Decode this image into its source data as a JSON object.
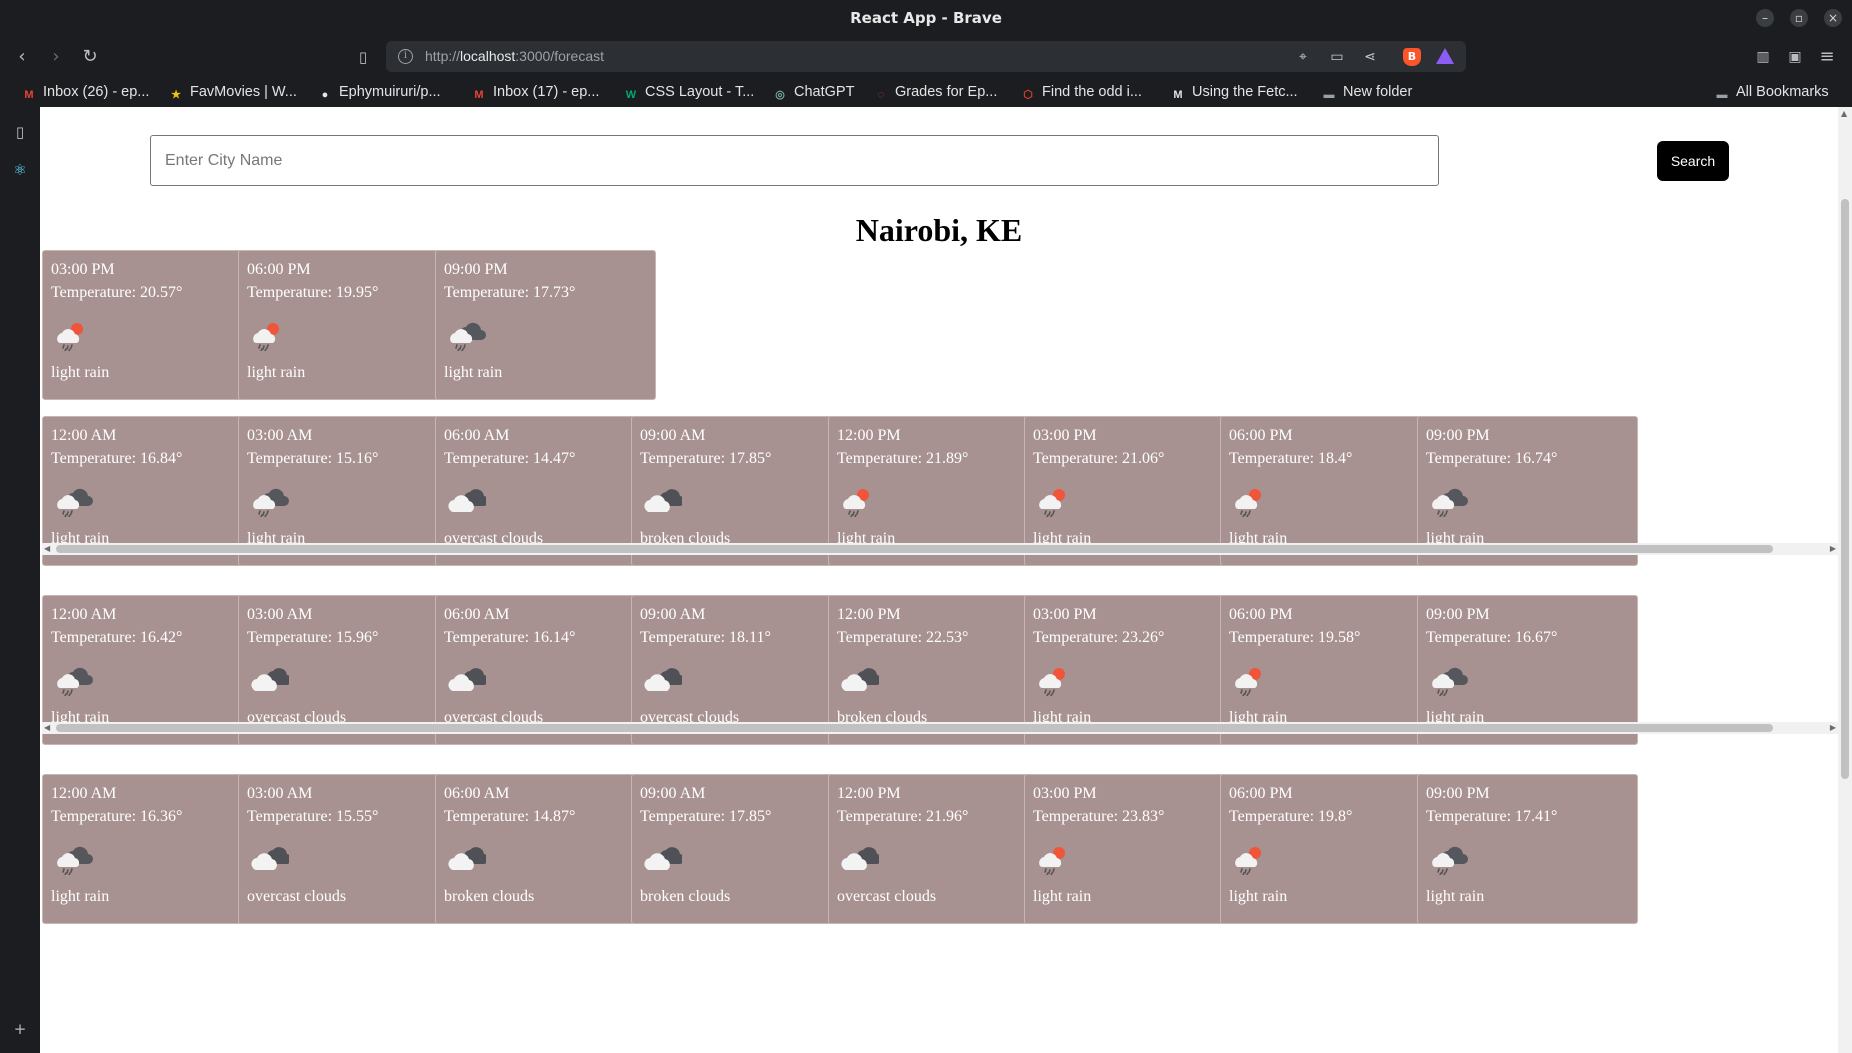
{
  "window": {
    "title": "React App - Brave",
    "controls": [
      "–",
      "▫",
      "×"
    ]
  },
  "toolbar": {
    "url_scheme": "http://",
    "url_host": "localhost",
    "url_path": ":3000/forecast"
  },
  "bookmarks": [
    {
      "label": "Inbox (26) - ep...",
      "icon": "gmail-icon",
      "color": "#ea4335",
      "glyph": "M"
    },
    {
      "label": "FavMovies | W...",
      "icon": "star-icon",
      "color": "#f4c20d",
      "glyph": "★"
    },
    {
      "label": "Ephymuiruri/p...",
      "icon": "github-icon",
      "color": "#e4e4e4",
      "glyph": "●"
    },
    {
      "label": "Inbox (17) - ep...",
      "icon": "gmail-icon",
      "color": "#ea4335",
      "glyph": "M"
    },
    {
      "label": "CSS Layout - T...",
      "icon": "w3schools-icon",
      "color": "#04aa6d",
      "glyph": "W"
    },
    {
      "label": "ChatGPT",
      "icon": "chatgpt-icon",
      "color": "#74aa9c",
      "glyph": "◎"
    },
    {
      "label": "Grades for Ep...",
      "icon": "canvas-icon",
      "color": "#e13f2b",
      "glyph": "◌"
    },
    {
      "label": "Find the odd i...",
      "icon": "codewars-icon",
      "color": "#e13f2b",
      "glyph": "⬡"
    },
    {
      "label": "Using the Fetc...",
      "icon": "mdn-icon",
      "color": "#e4e4e4",
      "glyph": "M"
    },
    {
      "label": "New folder",
      "icon": "folder-icon",
      "color": "#9aa0a6",
      "glyph": "▬"
    }
  ],
  "all_bookmarks_label": "All Bookmarks",
  "search": {
    "placeholder": "Enter City Name",
    "button_label": "Search"
  },
  "city": "Nairobi, KE",
  "days": [
    [
      {
        "time": "03:00 PM",
        "temp": "Temperature: 20.57°",
        "desc": "light rain",
        "icon": "rain-sun"
      },
      {
        "time": "06:00 PM",
        "temp": "Temperature: 19.95°",
        "desc": "light rain",
        "icon": "rain-sun"
      },
      {
        "time": "09:00 PM",
        "temp": "Temperature: 17.73°",
        "desc": "light rain",
        "icon": "rain-night"
      }
    ],
    [
      {
        "time": "12:00 AM",
        "temp": "Temperature: 16.84°",
        "desc": "light rain",
        "icon": "rain-night"
      },
      {
        "time": "03:00 AM",
        "temp": "Temperature: 15.16°",
        "desc": "light rain",
        "icon": "rain-night"
      },
      {
        "time": "06:00 AM",
        "temp": "Temperature: 14.47°",
        "desc": "overcast clouds",
        "icon": "clouds"
      },
      {
        "time": "09:00 AM",
        "temp": "Temperature: 17.85°",
        "desc": "broken clouds",
        "icon": "clouds"
      },
      {
        "time": "12:00 PM",
        "temp": "Temperature: 21.89°",
        "desc": "light rain",
        "icon": "rain-sun"
      },
      {
        "time": "03:00 PM",
        "temp": "Temperature: 21.06°",
        "desc": "light rain",
        "icon": "rain-sun"
      },
      {
        "time": "06:00 PM",
        "temp": "Temperature: 18.4°",
        "desc": "light rain",
        "icon": "rain-sun"
      },
      {
        "time": "09:00 PM",
        "temp": "Temperature: 16.74°",
        "desc": "light rain",
        "icon": "rain-night"
      }
    ],
    [
      {
        "time": "12:00 AM",
        "temp": "Temperature: 16.42°",
        "desc": "light rain",
        "icon": "rain-night"
      },
      {
        "time": "03:00 AM",
        "temp": "Temperature: 15.96°",
        "desc": "overcast clouds",
        "icon": "clouds"
      },
      {
        "time": "06:00 AM",
        "temp": "Temperature: 16.14°",
        "desc": "overcast clouds",
        "icon": "clouds"
      },
      {
        "time": "09:00 AM",
        "temp": "Temperature: 18.11°",
        "desc": "overcast clouds",
        "icon": "clouds"
      },
      {
        "time": "12:00 PM",
        "temp": "Temperature: 22.53°",
        "desc": "broken clouds",
        "icon": "clouds"
      },
      {
        "time": "03:00 PM",
        "temp": "Temperature: 23.26°",
        "desc": "light rain",
        "icon": "rain-sun"
      },
      {
        "time": "06:00 PM",
        "temp": "Temperature: 19.58°",
        "desc": "light rain",
        "icon": "rain-sun"
      },
      {
        "time": "09:00 PM",
        "temp": "Temperature: 16.67°",
        "desc": "light rain",
        "icon": "rain-night"
      }
    ],
    [
      {
        "time": "12:00 AM",
        "temp": "Temperature: 16.36°",
        "desc": "light rain",
        "icon": "rain-night"
      },
      {
        "time": "03:00 AM",
        "temp": "Temperature: 15.55°",
        "desc": "overcast clouds",
        "icon": "clouds"
      },
      {
        "time": "06:00 AM",
        "temp": "Temperature: 14.87°",
        "desc": "broken clouds",
        "icon": "clouds"
      },
      {
        "time": "09:00 AM",
        "temp": "Temperature: 17.85°",
        "desc": "broken clouds",
        "icon": "clouds"
      },
      {
        "time": "12:00 PM",
        "temp": "Temperature: 21.96°",
        "desc": "overcast clouds",
        "icon": "clouds"
      },
      {
        "time": "03:00 PM",
        "temp": "Temperature: 23.83°",
        "desc": "light rain",
        "icon": "rain-sun"
      },
      {
        "time": "06:00 PM",
        "temp": "Temperature: 19.8°",
        "desc": "light rain",
        "icon": "rain-sun"
      },
      {
        "time": "09:00 PM",
        "temp": "Temperature: 17.41°",
        "desc": "light rain",
        "icon": "rain-night"
      }
    ]
  ],
  "colors": {
    "card_bg": "#a89291",
    "browser_chrome": "#1b1d20",
    "search_button": "#000000"
  }
}
